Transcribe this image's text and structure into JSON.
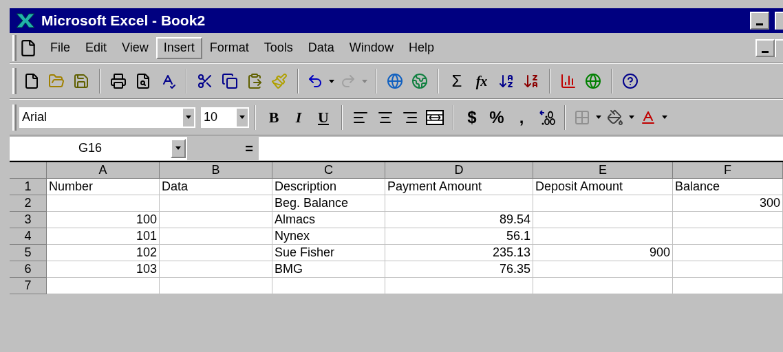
{
  "window": {
    "title": "Microsoft Excel - Book2"
  },
  "menu": [
    {
      "label": "File",
      "selected": false
    },
    {
      "label": "Edit",
      "selected": false
    },
    {
      "label": "View",
      "selected": false
    },
    {
      "label": "Insert",
      "selected": true
    },
    {
      "label": "Format",
      "selected": false
    },
    {
      "label": "Tools",
      "selected": false
    },
    {
      "label": "Data",
      "selected": false
    },
    {
      "label": "Window",
      "selected": false
    },
    {
      "label": "Help",
      "selected": false
    }
  ],
  "standard_toolbar": {
    "undo": {
      "disabled": false
    },
    "redo": {
      "disabled": true
    },
    "sum": "Σ",
    "function": "fx"
  },
  "formatting_toolbar": {
    "font": "Arial",
    "size": "10",
    "styles": [
      "B",
      "I",
      "U"
    ],
    "number_formats": [
      "$",
      "%",
      ","
    ]
  },
  "formula_bar": {
    "name_box": "G16",
    "equals": "="
  },
  "sheet": {
    "columns": [
      "A",
      "B",
      "C",
      "D",
      "E",
      "F"
    ],
    "rows": [
      {
        "header": "1",
        "cells": [
          {
            "kind": "text",
            "text": "Number"
          },
          {
            "kind": "text",
            "text": "Data"
          },
          {
            "kind": "text",
            "text": "Description"
          },
          {
            "kind": "text",
            "text": "Payment Amount"
          },
          {
            "kind": "text",
            "text": "Deposit Amount"
          },
          {
            "kind": "text",
            "text": "Balance"
          }
        ]
      },
      {
        "header": "2",
        "cells": [
          {
            "kind": "blank"
          },
          {
            "kind": "blank"
          },
          {
            "kind": "text",
            "text": "Beg. Balance"
          },
          {
            "kind": "blank"
          },
          {
            "kind": "blank"
          },
          {
            "kind": "number",
            "text": "300"
          }
        ]
      },
      {
        "header": "3",
        "cells": [
          {
            "kind": "number",
            "text": "100"
          },
          {
            "kind": "blank"
          },
          {
            "kind": "text",
            "text": "Almacs"
          },
          {
            "kind": "number",
            "text": "89.54"
          },
          {
            "kind": "blank"
          },
          {
            "kind": "blank"
          }
        ]
      },
      {
        "header": "4",
        "cells": [
          {
            "kind": "number",
            "text": "101"
          },
          {
            "kind": "blank"
          },
          {
            "kind": "text",
            "text": "Nynex"
          },
          {
            "kind": "number",
            "text": "56.1"
          },
          {
            "kind": "blank"
          },
          {
            "kind": "blank"
          }
        ]
      },
      {
        "header": "5",
        "cells": [
          {
            "kind": "number",
            "text": "102"
          },
          {
            "kind": "blank"
          },
          {
            "kind": "text",
            "text": "Sue Fisher"
          },
          {
            "kind": "number",
            "text": "235.13"
          },
          {
            "kind": "number",
            "text": "900"
          },
          {
            "kind": "blank"
          }
        ]
      },
      {
        "header": "6",
        "cells": [
          {
            "kind": "number",
            "text": "103"
          },
          {
            "kind": "blank"
          },
          {
            "kind": "text",
            "text": "BMG"
          },
          {
            "kind": "number",
            "text": "76.35"
          },
          {
            "kind": "blank"
          },
          {
            "kind": "blank"
          }
        ]
      },
      {
        "header": "7",
        "cells": [
          {
            "kind": "blank"
          },
          {
            "kind": "blank"
          },
          {
            "kind": "blank"
          },
          {
            "kind": "blank"
          },
          {
            "kind": "blank"
          },
          {
            "kind": "blank"
          }
        ]
      }
    ]
  }
}
